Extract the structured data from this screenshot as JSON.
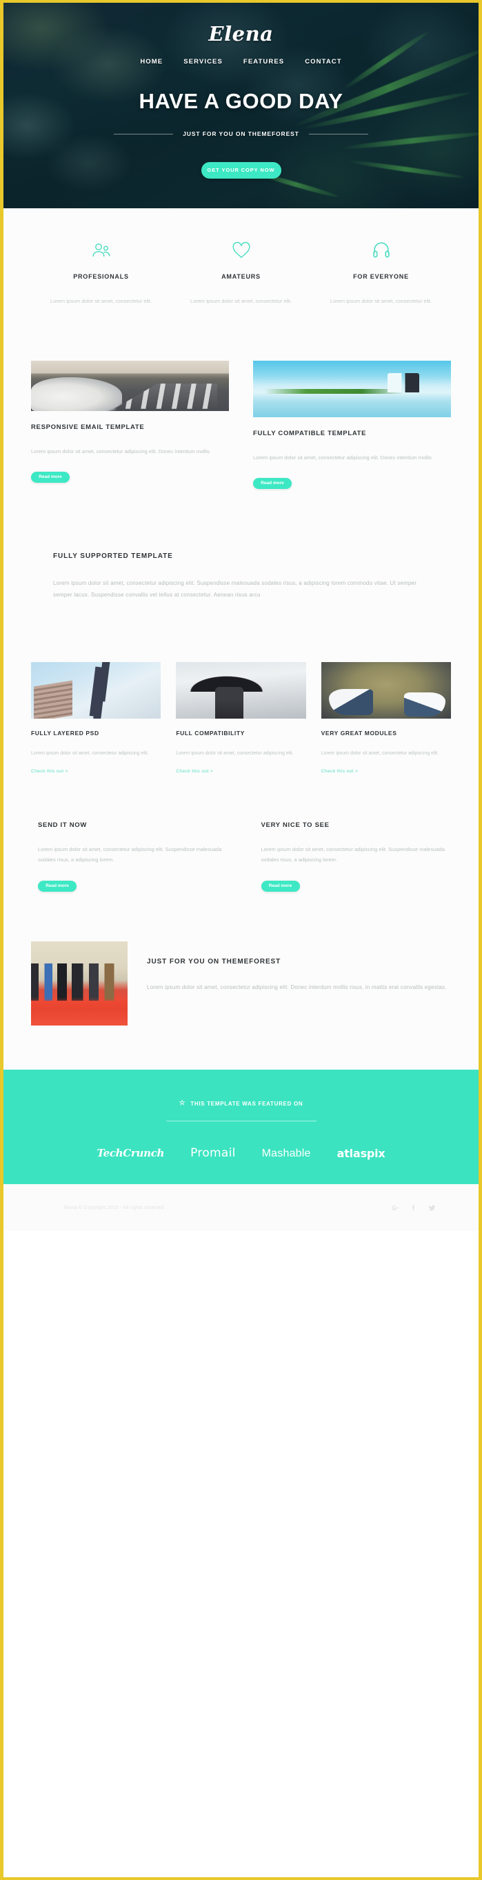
{
  "theme": {
    "accent": "#3de8c4",
    "border": "#e8c82a",
    "heading": "#2f3337",
    "muted": "#bcc1c3",
    "link": "#59dfc2"
  },
  "hero": {
    "logo": "Elena",
    "nav": [
      {
        "label": "HOME"
      },
      {
        "label": "SERVICES"
      },
      {
        "label": "FEATURES"
      },
      {
        "label": "CONTACT"
      }
    ],
    "title": "HAVE A GOOD DAY",
    "subtitle": "JUST FOR YOU ON THEMEFOREST",
    "cta_label": "GET YOUR COPY NOW"
  },
  "features": [
    {
      "icon": "users-icon",
      "title": "PROFESIONALS",
      "text": "Lorem ipsum dolor sit amet, consectetur elit."
    },
    {
      "icon": "heart-icon",
      "title": "AMATEURS",
      "text": "Lorem ipsum dolor sit amet, consectetur elit."
    },
    {
      "icon": "headphones-icon",
      "title": "FOR EVERYONE",
      "text": "Lorem ipsum dolor sit amet, consectetur elit."
    }
  ],
  "two_col": [
    {
      "image": "vintage-car-on-road-photo",
      "title": "RESPONSIVE EMAIL TEMPLATE",
      "text": "Lorem ipsum dolor sit amet, consectetur adipiscing elit. Donec interdum mollis",
      "button": "Read more"
    },
    {
      "image": "couple-on-beach-photo",
      "title": "FULLY COMPATIBLE TEMPLATE",
      "text": "Lorem ipsum dolor sit amet, consectetur adipiscing elit. Donec interdum mollis",
      "button": "Read more"
    }
  ],
  "full_block": {
    "title": "FULLY SUPPORTED TEMPLATE",
    "text": "Lorem ipsum dolor sit amet, consectetur adipiscing elit. Suspendisse malesuada sodales risus, a adipiscing lorem commodo vitae. Ut semper semper lacus. Suspendisse convallis vel tellus at consectetur. Aenean risus arcu"
  },
  "three_col": [
    {
      "image": "traffic-light-photo",
      "title": "FULLY LAYERED PSD",
      "text": "Lorem ipsum dolor sit amet, consectetur adipiscing elit.",
      "link": "Check this out  >"
    },
    {
      "image": "girl-with-umbrella-photo",
      "title": "FULL COMPATIBILITY",
      "text": "Lorem ipsum dolor sit amet, consectetur adipiscing elit.",
      "link": "Check this out  >"
    },
    {
      "image": "sneakers-on-pavement-photo",
      "title": "VERY GREAT MODULES",
      "text": "Lorem ipsum dolor sit amet, consectetur adipiscing elit.",
      "link": "Check this out  >"
    }
  ],
  "pair": [
    {
      "title": "SEND IT NOW",
      "text": "Lorem ipsum dolor sit amet, consectetur adipiscing elit. Suspendisse malesuada sodales risus, a adipiscing lorem.",
      "button": "Read more"
    },
    {
      "title": "VERY NICE TO SEE",
      "text": "Lorem ipsum dolor sit amet, consectetur adipiscing elit. Suspendisse malesuada sodales risus, a adipiscing lorem.",
      "button": "Read more"
    }
  ],
  "split": {
    "image": "red-carpet-crowd-photo",
    "title": "JUST FOR YOU ON THEMEFOREST",
    "text": "Lorem ipsum dolor sit amet, consectetur adipiscing elit. Donec interdum mollis risus, in mattis erat convallis egestas."
  },
  "featured": {
    "star": "☆",
    "heading": "THIS TEMPLATE WAS FEATURED ON",
    "brands": [
      {
        "name": "TechCrunch"
      },
      {
        "name": "Promail"
      },
      {
        "name": "Mashable"
      },
      {
        "name": "atlaspix"
      }
    ]
  },
  "bottom": {
    "copyright": "Elena © Copyright 2015 - All rights reserved",
    "socials": [
      {
        "icon": "google-plus-icon"
      },
      {
        "icon": "facebook-icon"
      },
      {
        "icon": "twitter-icon"
      }
    ]
  }
}
